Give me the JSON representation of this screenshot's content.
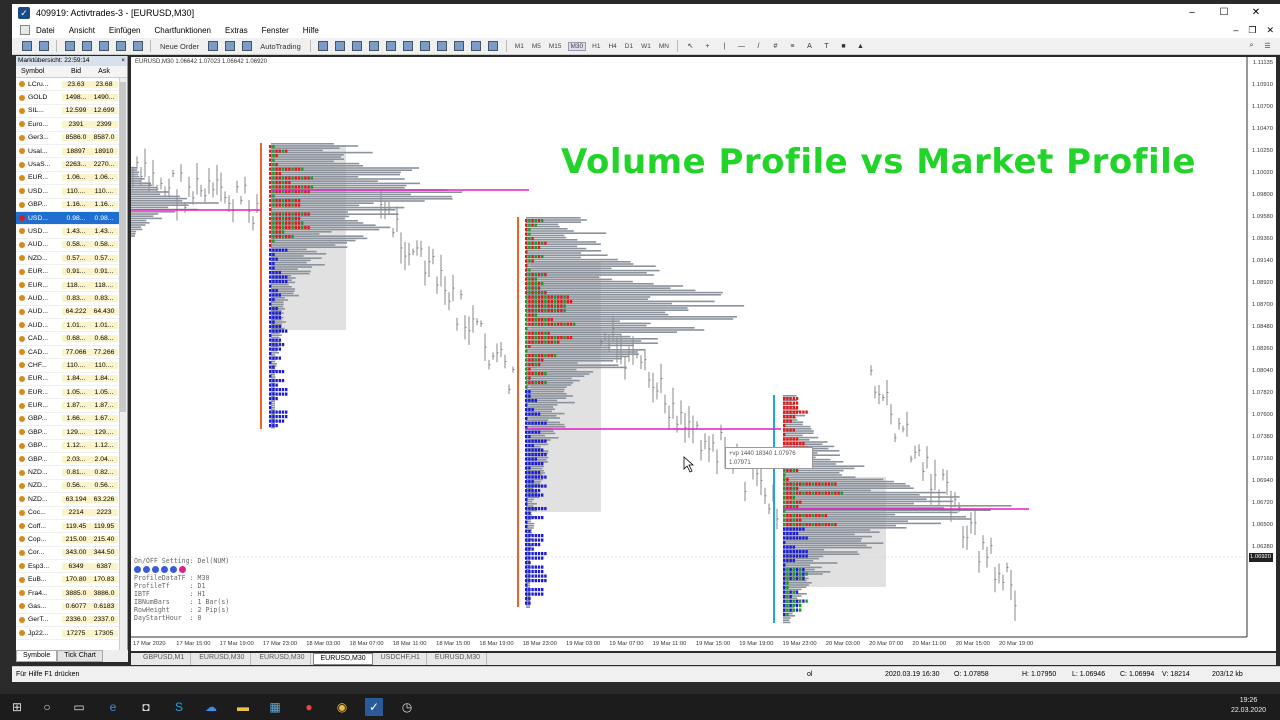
{
  "window": {
    "title": "409919: Activtrades-3 - [EURUSD,M30]",
    "buttons": [
      "–",
      "☐",
      "✕"
    ]
  },
  "menu": {
    "items": [
      "Datei",
      "Ansicht",
      "Einfügen",
      "Chartfunktionen",
      "Extras",
      "Fenster",
      "Hilfe"
    ],
    "mdi": [
      "–",
      "❐",
      "✕"
    ]
  },
  "toolbar": {
    "new_order": "Neue Order",
    "autotrading": "AutoTrading",
    "timeframes": [
      "M1",
      "M5",
      "M15",
      "M30",
      "H1",
      "H4",
      "D1",
      "W1",
      "MN"
    ],
    "active_timeframe": "M30"
  },
  "market_watch": {
    "header": "Marktübersicht: 22:59:14",
    "columns": [
      "Symbol",
      "Bid",
      "Ask"
    ],
    "rows": [
      {
        "symbol": "LCru...",
        "bid": "23.63",
        "ask": "23.68",
        "color": "#d98a1c"
      },
      {
        "symbol": "GOLD",
        "bid": "1498...",
        "ask": "1490...",
        "color": "#d98a1c"
      },
      {
        "symbol": "SIL...",
        "bid": "12.599",
        "ask": "12.699",
        "color": "#d98a1c"
      },
      {
        "symbol": "Euro...",
        "bid": "2391",
        "ask": "2399",
        "color": "#d98a1c"
      },
      {
        "symbol": "Ger3...",
        "bid": "8586.0",
        "ask": "8587.0",
        "color": "#d98a1c"
      },
      {
        "symbol": "UsaI...",
        "bid": "18897",
        "ask": "18910",
        "color": "#d98a1c"
      },
      {
        "symbol": "UsaS...",
        "bid": "2263...",
        "ask": "2270...",
        "color": "#d98a1c"
      },
      {
        "symbol": "EUR...",
        "bid": "1.06...",
        "ask": "1.06...",
        "color": "#d98a1c"
      },
      {
        "symbol": "USD...",
        "bid": "110....",
        "ask": "110....",
        "color": "#d98a1c"
      },
      {
        "symbol": "GBP...",
        "bid": "1.16...",
        "ask": "1.16...",
        "color": "#d98a1c"
      },
      {
        "symbol": "USD...",
        "bid": "0.98...",
        "ask": "0.98...",
        "color": "#d02020",
        "selected": true
      },
      {
        "symbol": "USD...",
        "bid": "1.43...",
        "ask": "1.43...",
        "color": "#d98a1c"
      },
      {
        "symbol": "AUD...",
        "bid": "0.58...",
        "ask": "0.58...",
        "color": "#d98a1c"
      },
      {
        "symbol": "NZD...",
        "bid": "0.57...",
        "ask": "0.57...",
        "color": "#d98a1c"
      },
      {
        "symbol": "EUR...",
        "bid": "0.91...",
        "ask": "0.91...",
        "color": "#d98a1c"
      },
      {
        "symbol": "EUR...",
        "bid": "118....",
        "ask": "118....",
        "color": "#d98a1c"
      },
      {
        "symbol": "AUD...",
        "bid": "0.83...",
        "ask": "0.83...",
        "color": "#d98a1c"
      },
      {
        "symbol": "AUD...",
        "bid": "64.222",
        "ask": "64.430",
        "color": "#d98a1c"
      },
      {
        "symbol": "AUD...",
        "bid": "1.01...",
        "ask": "1.01...",
        "color": "#d98a1c"
      },
      {
        "symbol": "CAD...",
        "bid": "0.68...",
        "ask": "0.68...",
        "color": "#d98a1c"
      },
      {
        "symbol": "CAD...",
        "bid": "77.066",
        "ask": "77.266",
        "color": "#d98a1c"
      },
      {
        "symbol": "CHF...",
        "bid": "110....",
        "ask": "110....",
        "color": "#d98a1c"
      },
      {
        "symbol": "EUR...",
        "bid": "1.84...",
        "ask": "1.84...",
        "color": "#d98a1c"
      },
      {
        "symbol": "EUR...",
        "bid": "1.05...",
        "ask": "1.05...",
        "color": "#d98a1c"
      },
      {
        "symbol": "EUR...",
        "bid": "1.87...",
        "ask": "1.87...",
        "color": "#d98a1c"
      },
      {
        "symbol": "GBP...",
        "bid": "1.66...",
        "ask": "1.67...",
        "color": "#d98a1c"
      },
      {
        "symbol": "GBP...",
        "bid": "129....",
        "ask": "129....",
        "color": "#d98a1c"
      },
      {
        "symbol": "GBP...",
        "bid": "1.12...",
        "ask": "1.12...",
        "color": "#d98a1c"
      },
      {
        "symbol": "GBP...",
        "bid": "2.03...",
        "ask": "2.04...",
        "color": "#d98a1c"
      },
      {
        "symbol": "NZD...",
        "bid": "0.81...",
        "ask": "0.82...",
        "color": "#d98a1c"
      },
      {
        "symbol": "NZD...",
        "bid": "0.56...",
        "ask": "0.56...",
        "color": "#d98a1c"
      },
      {
        "symbol": "NZD...",
        "bid": "63.194",
        "ask": "63.226",
        "color": "#d98a1c"
      },
      {
        "symbol": "Coc...",
        "bid": "2214",
        "ask": "2223",
        "color": "#d98a1c"
      },
      {
        "symbol": "Coff...",
        "bid": "119.45",
        "ask": "119.95",
        "color": "#d98a1c"
      },
      {
        "symbol": "Cop...",
        "bid": "215.00",
        "ask": "215.40",
        "color": "#d98a1c"
      },
      {
        "symbol": "Cor...",
        "bid": "343.00",
        "ask": "344.50",
        "color": "#d98a1c"
      },
      {
        "symbol": "Esp3...",
        "bid": "6349",
        "ask": "6387",
        "color": "#d98a1c"
      },
      {
        "symbol": "EuB...",
        "bid": "170.80",
        "ask": "170.83",
        "color": "#d98a1c"
      },
      {
        "symbol": "Fra4...",
        "bid": "3885.0",
        "ask": "3886.0",
        "color": "#d98a1c"
      },
      {
        "symbol": "Gas...",
        "bid": "0.6077",
        "ask": "0.6183",
        "color": "#d98a1c"
      },
      {
        "symbol": "GerT...",
        "bid": "2336.0",
        "ask": "2337.0",
        "color": "#d98a1c"
      },
      {
        "symbol": "Jp22...",
        "bid": "17275",
        "ask": "17305",
        "color": "#d98a1c"
      }
    ],
    "tabs": [
      "Symbole",
      "Tick Chart"
    ]
  },
  "chart": {
    "info": "EURUSD,M30  1.06642 1.07023 1.06642 1.06920",
    "headline": "Volume Profile  vs  Market Profile",
    "tooltip_line1": "+vp 1440 18340 1.07976",
    "tooltip_line2": "1.07971",
    "current_price": "1.06920",
    "price_axis": [
      "1.11135",
      "1.10910",
      "1.10700",
      "1.10470",
      "1.10250",
      "1.10020",
      "1.09800",
      "1.09580",
      "1.09360",
      "1.09140",
      "1.08920",
      "1.08700",
      "1.08480",
      "1.08260",
      "1.08040",
      "1.07820",
      "1.07600",
      "1.07380",
      "1.07160",
      "1.06940",
      "1.06720",
      "1.06500",
      "1.06280"
    ],
    "time_axis": [
      "17 Mar 2020",
      "17 Mar 15:00",
      "17 Mar 19:00",
      "17 Mar 23:00",
      "18 Mar 03:00",
      "18 Mar 07:00",
      "18 Mar 11:00",
      "18 Mar 15:00",
      "18 Mar 19:00",
      "18 Mar 23:00",
      "19 Mar 03:00",
      "19 Mar 07:00",
      "19 Mar 11:00",
      "19 Mar 15:00",
      "19 Mar 19:00",
      "19 Mar 23:00",
      "20 Mar 03:00",
      "20 Mar 07:00",
      "20 Mar 11:00",
      "20 Mar 15:00",
      "20 Mar 19:00"
    ],
    "settings": {
      "title": "On/OFF Setting: Del(NUM)",
      "lines": [
        "ProfileDataTF : M30",
        "ProfileTf     : D1",
        "IBTF          : H1",
        "IBNumBars     : 1 Bar(s)",
        "RowHeight     : 2 Pip(s)",
        "DayStartHour  : 0"
      ],
      "dot_colors": [
        "#3a5bd8",
        "#3a5bd8",
        "#3a5bd8",
        "#3a5bd8",
        "#3a5bd8",
        "#e0208a"
      ]
    },
    "colors": {
      "volume": "#8c929c",
      "poc": "#e020c0",
      "tpo_red": "#e01818",
      "tpo_green": "#1a9a2a",
      "tpo_blue": "#1a1ad8",
      "ib_orange": "#f0602a",
      "ib_cyan": "#1aa8e0",
      "value_area": "#d4d4d4"
    }
  },
  "chart_tabs": [
    "GBPUSD,M1",
    "EURUSD,M30",
    "EURUSD,M30",
    "EURUSD,M30",
    "USDCHF,H1",
    "EURUSD,M30"
  ],
  "active_chart_tab": 3,
  "status": {
    "help": "Für Hilfe F1 drücken",
    "profile": "ol",
    "datetime": "2020.03.19 16:30",
    "open": "O: 1.07858",
    "high": "H: 1.07950",
    "low": "L: 1.06946",
    "close": "C: 1.06994",
    "volume": "V: 18214",
    "traffic": "203/12 kb"
  },
  "taskbar": {
    "time": "19:26",
    "date": "22.03.2020"
  }
}
